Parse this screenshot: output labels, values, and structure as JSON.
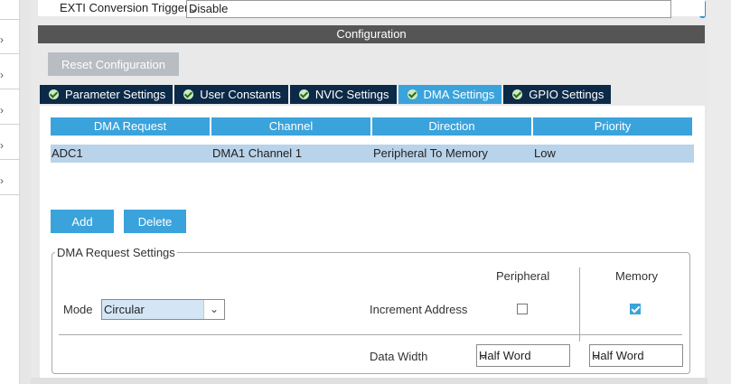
{
  "trigger": {
    "label": "EXTI Conversion Trigger",
    "value": "Disable"
  },
  "configuration": {
    "title": "Configuration",
    "reset_label": "Reset Configuration"
  },
  "tabs": [
    {
      "label": "Parameter Settings",
      "active": false
    },
    {
      "label": "User Constants",
      "active": false
    },
    {
      "label": "NVIC Settings",
      "active": false
    },
    {
      "label": "DMA Settings",
      "active": true
    },
    {
      "label": "GPIO Settings",
      "active": false
    }
  ],
  "dma_table": {
    "columns": [
      "DMA Request",
      "Channel",
      "Direction",
      "Priority"
    ],
    "rows": [
      [
        "ADC1",
        "DMA1 Channel 1",
        "Peripheral To Memory",
        "Low"
      ]
    ]
  },
  "buttons": {
    "add": "Add",
    "delete": "Delete"
  },
  "dma_request_settings": {
    "legend": "DMA Request Settings",
    "mode_label": "Mode",
    "mode_value": "Circular",
    "peripheral_header": "Peripheral",
    "memory_header": "Memory",
    "increment_label": "Increment Address",
    "peripheral_increment": false,
    "memory_increment": true,
    "data_width_label": "Data Width",
    "peripheral_width": "Half Word",
    "memory_width": "Half Word"
  },
  "icons": {
    "tab_status": "check-circle-icon",
    "tree_expand": "chevron-right-icon",
    "dropdown": "chevron-down-icon"
  },
  "colors": {
    "accent": "#3aa3dc",
    "tab_dark": "#0c2a48",
    "header_bar": "#555555",
    "selected_row": "#b9d3ea"
  }
}
